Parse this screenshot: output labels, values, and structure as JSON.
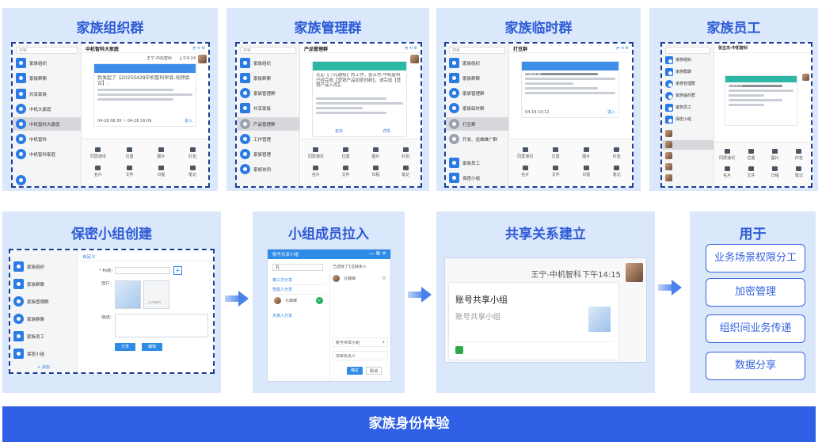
{
  "panels": {
    "org_group": {
      "title": "家族组织群",
      "search_placeholder": "搜索",
      "chat_title": "中机智科大家庭",
      "sidebar": [
        "家族组织",
        "家族群聊",
        "共享家族",
        "中机大家庭",
        "中机智科大家庭",
        "中机智科",
        "中机智科家庭"
      ],
      "sender": "王宁-中机智科",
      "time": "上午9:24",
      "card_title": "我发起了【20250428中机智科早会-视频会议】:",
      "card_time": "04-28 08:30 ~ 04-28 16:09",
      "card_action": "进入",
      "tools": [
        "同屏通讯",
        "位置",
        "图片",
        "红包",
        "名片",
        "文件",
        "日程",
        "笔记"
      ]
    },
    "admin_group": {
      "title": "家族管理群",
      "search_placeholder": "搜索",
      "chat_title": "产品管理群",
      "sidebar": [
        "家族组织",
        "家族群聊",
        "家族管理群",
        "共享家族",
        "产品管理群",
        "工作管理",
        "家族管理",
        "家族协同"
      ],
      "card_title": "小元通知",
      "card_text": "发起【小元通知】的工作，张五杰-中机智科已经完成【营销产品加密创新】，请完成【营销产品入库】。",
      "actions": [
        "去办",
        "详情"
      ],
      "tools": [
        "同屏通讯",
        "位置",
        "图片",
        "红包",
        "名片",
        "文件",
        "日程",
        "笔记"
      ]
    },
    "temp_group": {
      "title": "家族临时群",
      "search_placeholder": "搜索",
      "chat_title": "打豆群",
      "sidebar": [
        "家族组织",
        "家族群聊",
        "家族管理群",
        "家族临时群",
        "打豆群",
        "开发、运维推广群",
        "家族员工",
        "保密小组"
      ],
      "card_title": "问题反馈",
      "card_time": "04-16 10:12",
      "card_action": "进入",
      "tools": [
        "同屏通讯",
        "位置",
        "图片",
        "红包",
        "名片",
        "文件",
        "日程",
        "笔记"
      ]
    },
    "staff": {
      "title": "家族员工",
      "chat_title": "张五杰-中机智科",
      "sidebar": [
        "家族组织",
        "家族群聊",
        "家族管理群",
        "家族临时群",
        "家族员工",
        "保密小组"
      ],
      "card_title": "专项会议",
      "tools": [
        "同屏通讯",
        "位置",
        "图片",
        "红包",
        "名片",
        "文件",
        "日程",
        "笔记"
      ]
    },
    "secret_group": {
      "title": "保密小组创建",
      "header_label": "自定义",
      "sidebar": [
        "家族组织",
        "家族群聊",
        "家族管理群",
        "家族群聊",
        "家族员工",
        "保密小组"
      ],
      "form": {
        "name_label": "* 标题:",
        "image_label": "图片:",
        "desc_label": "描述:",
        "image_placeholder": "上传图片"
      },
      "buttons": [
        "分享",
        "编辑"
      ],
      "add_label": "+ 添加"
    },
    "member_pull": {
      "title": "小组成员拉入",
      "dialog_title": "账号共享小组",
      "search_value": "孔",
      "selected_hint": "已选择了1位联系人",
      "tree": [
        "第三方分享",
        "智能人分享",
        "孔蝶蝶",
        "无家人分享"
      ],
      "selected_member": "孔蝶蝶",
      "rows": [
        "账号共享小组",
        "项目负责人"
      ],
      "buttons": [
        "确定",
        "取消"
      ]
    },
    "share_build": {
      "title": "共享关系建立",
      "sender": "王宁-中机智科",
      "time": "下午14:15",
      "card_title": "账号共享小组",
      "card_subtitle": "账号共享小组"
    },
    "usage": {
      "title": "用于",
      "items": [
        "业务场景权限分工",
        "加密管理",
        "组织间业务传递",
        "数据分享"
      ]
    }
  },
  "footer": {
    "text": "家族身份体验"
  }
}
